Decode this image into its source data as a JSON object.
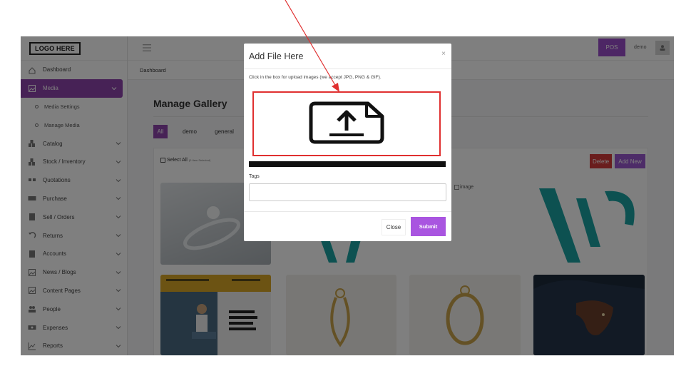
{
  "app": {
    "logo": "LOGO HERE",
    "pos_label": "POS",
    "user_name": "demo"
  },
  "sidebar": {
    "items": [
      {
        "label": "Dashboard",
        "icon": "home-icon",
        "chevron": false
      },
      {
        "label": "Media",
        "icon": "image-icon",
        "chevron": true,
        "active": true
      },
      {
        "label": "Media Settings",
        "sub": true
      },
      {
        "label": "Manage Media",
        "sub": true
      },
      {
        "label": "Catalog",
        "icon": "boxes-icon",
        "chevron": true
      },
      {
        "label": "Stock / Inventory",
        "icon": "boxes-icon",
        "chevron": true
      },
      {
        "label": "Quotations",
        "icon": "quote-icon",
        "chevron": true
      },
      {
        "label": "Purchase",
        "icon": "keyboard-icon",
        "chevron": true
      },
      {
        "label": "Sell / Orders",
        "icon": "clipboard-icon",
        "chevron": true
      },
      {
        "label": "Returns",
        "icon": "undo-icon",
        "chevron": true
      },
      {
        "label": "Accounts",
        "icon": "document-icon",
        "chevron": true
      },
      {
        "label": "News / Blogs",
        "icon": "image-icon",
        "chevron": true
      },
      {
        "label": "Content Pages",
        "icon": "image-icon",
        "chevron": true
      },
      {
        "label": "People",
        "icon": "people-icon",
        "chevron": true
      },
      {
        "label": "Expenses",
        "icon": "money-icon",
        "chevron": true
      },
      {
        "label": "Reports",
        "icon": "chart-icon",
        "chevron": true
      }
    ]
  },
  "breadcrumb": "Dashboard",
  "main": {
    "title": "Manage Gallery",
    "filters": [
      "All",
      "demo",
      "general"
    ],
    "select_all": "Select All",
    "selected_count": "(0 Item Selected)",
    "delete_label": "Delete",
    "add_new_label": "Add New",
    "broken_image_alt": "image"
  },
  "modal": {
    "title": "Add File Here",
    "close_glyph": "×",
    "hint": "Click in the box for upload images (we accept JPG, PNG & GIF).",
    "tags_label": "Tags",
    "tags_value": "",
    "close_label": "Close",
    "submit_label": "Submit"
  },
  "colors": {
    "accent": "#8e44ad",
    "submit": "#a955e0",
    "delete": "#d43a3a",
    "annotation": "#e03030"
  }
}
